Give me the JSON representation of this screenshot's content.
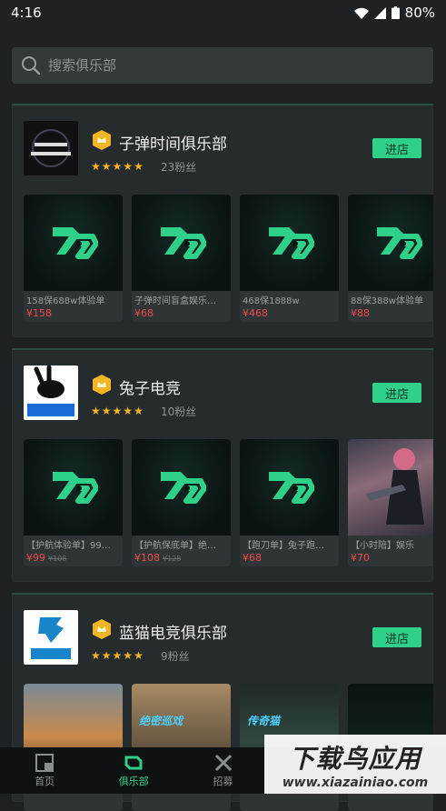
{
  "status": {
    "time": "4:16",
    "battery": "80%"
  },
  "search": {
    "placeholder": "搜索俱乐部"
  },
  "clubs": [
    {
      "name": "子弹时间俱乐部",
      "fans": "23粉丝",
      "enter": "进店",
      "stars": 5,
      "products": [
        {
          "title": "158保688w体验单",
          "price": "¥158",
          "old": ""
        },
        {
          "title": "子弹时间盲盒娱乐…",
          "price": "¥68",
          "old": ""
        },
        {
          "title": "468保1888w",
          "price": "¥468",
          "old": ""
        },
        {
          "title": "88保388w体验单",
          "price": "¥88",
          "old": ""
        }
      ]
    },
    {
      "name": "兔子电竞",
      "fans": "10粉丝",
      "enter": "进店",
      "stars": 5,
      "products": [
        {
          "title": "【护航体验单】99…",
          "price": "¥99",
          "old": "¥108"
        },
        {
          "title": "【护航保底单】绝…",
          "price": "¥108",
          "old": "¥128"
        },
        {
          "title": "【跑刀单】兔子跑…",
          "price": "¥68",
          "old": ""
        },
        {
          "title": "【小时陪】娱乐",
          "price": "¥70",
          "old": ""
        }
      ]
    },
    {
      "name": "蓝猫电竞俱乐部",
      "fans": "9粉丝",
      "enter": "进店",
      "stars": 5,
      "products": [
        {
          "title": "",
          "price": "",
          "old": "",
          "overlay": ""
        },
        {
          "title": "",
          "price": "",
          "old": "",
          "overlay": "绝密巡戏"
        },
        {
          "title": "",
          "price": "",
          "old": "",
          "overlay": "传奇猫"
        },
        {
          "title": "",
          "price": "",
          "old": "",
          "overlay": ""
        }
      ]
    }
  ],
  "tabs": [
    {
      "label": "首页",
      "icon": "home-icon"
    },
    {
      "label": "俱乐部",
      "icon": "club-icon"
    },
    {
      "label": "招募",
      "icon": "recruit-icon"
    },
    {
      "label": "",
      "icon": ""
    },
    {
      "label": "",
      "icon": ""
    }
  ],
  "watermark": {
    "title": "下载鸟应用",
    "url": "www.xiazainiao.com"
  },
  "colors": {
    "accent": "#2fd08a",
    "price": "#ee4b4b",
    "star": "#f2b526"
  }
}
